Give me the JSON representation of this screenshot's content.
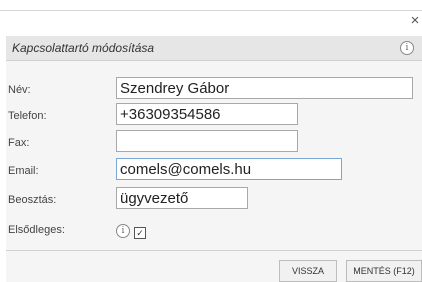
{
  "window": {
    "close_glyph": "×"
  },
  "dialog": {
    "title": "Kapcsolattartó módosítása",
    "info_glyph": "i"
  },
  "form": {
    "name": {
      "label": "Név:",
      "value": "Szendrey Gábor"
    },
    "phone": {
      "label": "Telefon:",
      "value": "+36309354586"
    },
    "fax": {
      "label": "Fax:",
      "value": ""
    },
    "email": {
      "label": "Email:",
      "value": "comels@comels.hu"
    },
    "position": {
      "label": "Beosztás:",
      "value": "ügyvezető"
    },
    "primary": {
      "label": "Elsődleges:",
      "info_glyph": "i",
      "checked": true,
      "check_glyph": "✓"
    }
  },
  "buttons": {
    "back": "VISSZA",
    "save": "MENTÉS (F12)"
  }
}
